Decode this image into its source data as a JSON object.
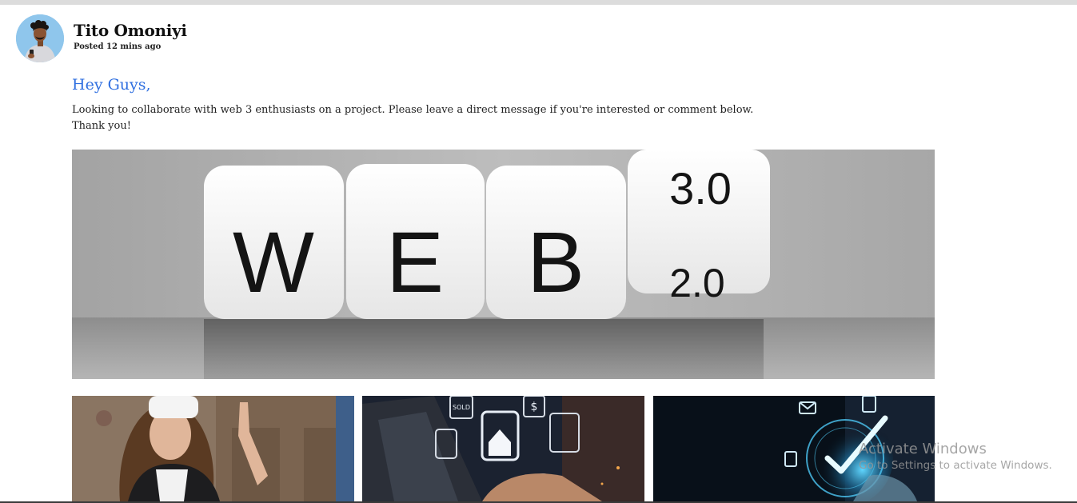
{
  "post": {
    "author": "Tito Omoniyi",
    "posted": "Posted 12 mins ago",
    "greeting": "Hey Guys,",
    "body_line1": "Looking to collaborate with web 3 enthusiasts on a project. Please leave a direct message if you're interested or comment below.",
    "body_line2": "Thank you!"
  },
  "hero": {
    "letters": [
      "W",
      "E",
      "B"
    ],
    "top_version": "3.0",
    "bottom_version": "2.0"
  },
  "thumbnails": {
    "shop_badge": "SOLD",
    "dollar_symbol": "$"
  },
  "watermark": {
    "title": "Activate Windows",
    "subtitle": "Go to Settings to activate Windows."
  },
  "colors": {
    "accent": "#2f6fe0",
    "hero_background": "#a9a9a9"
  }
}
